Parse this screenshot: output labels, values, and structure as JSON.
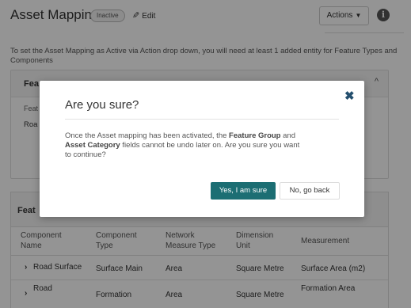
{
  "header": {
    "title": "Asset Mapping",
    "status_badge": "Inactive",
    "edit_label": "Edit",
    "actions_label": "Actions"
  },
  "notice": "To set the Asset Mapping as Active via Action drop down, you will need at least 1 added entity for Feature Types and Components",
  "feature_panel": {
    "title": "Fea",
    "label": "Feat",
    "value": "Roa"
  },
  "component_panel": {
    "title": "Feat"
  },
  "table": {
    "columns": [
      "Component Name",
      "Component Type",
      "Network Measure Type",
      "Dimension Unit",
      "Measurement"
    ],
    "rows": [
      [
        "Road Surface",
        "Surface Main",
        "Area",
        "Square Metre",
        "Surface Area (m2)"
      ],
      [
        "Road",
        "Formation",
        "Area",
        "Square Metre",
        "Formation Area"
      ]
    ]
  },
  "modal": {
    "title": "Are you sure?",
    "body_intro": "Once the Asset mapping has been activated, the ",
    "body_bold_1": "Feature Group",
    "body_and": " and ",
    "body_bold_2": "Asset Category",
    "body_rest": " fields cannot be undo later on. Are you sure you want to continue?",
    "confirm_label": "Yes, I am sure",
    "cancel_label": "No, go back"
  },
  "colors": {
    "primary_button": "#1c6e73",
    "close_icon": "#244f6e",
    "overlay": "rgba(0,0,0,0.42)"
  }
}
